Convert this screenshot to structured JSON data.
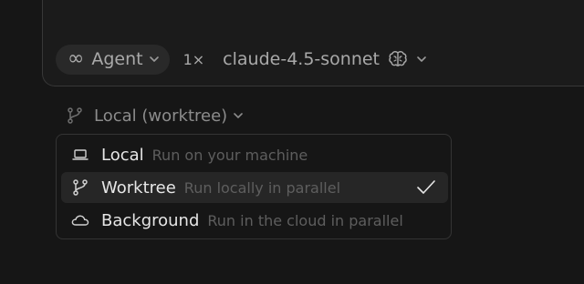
{
  "toolbar": {
    "agent_label": "Agent",
    "multiplier": "1×",
    "model_name": "claude-4.5-sonnet"
  },
  "environment": {
    "selected_label": "Local (worktree)"
  },
  "menu": {
    "items": [
      {
        "title": "Local",
        "description": "Run on your machine",
        "icon": "laptop-icon",
        "selected": false
      },
      {
        "title": "Worktree",
        "description": "Run locally in parallel",
        "icon": "git-branch-icon",
        "selected": true
      },
      {
        "title": "Background",
        "description": "Run in the cloud in parallel",
        "icon": "cloud-icon",
        "selected": false
      }
    ]
  },
  "colors": {
    "background": "#161616",
    "panel_border": "#383838",
    "selected_row": "#262626",
    "text_primary": "#e6e6e6",
    "text_muted": "#5e5e5e"
  }
}
